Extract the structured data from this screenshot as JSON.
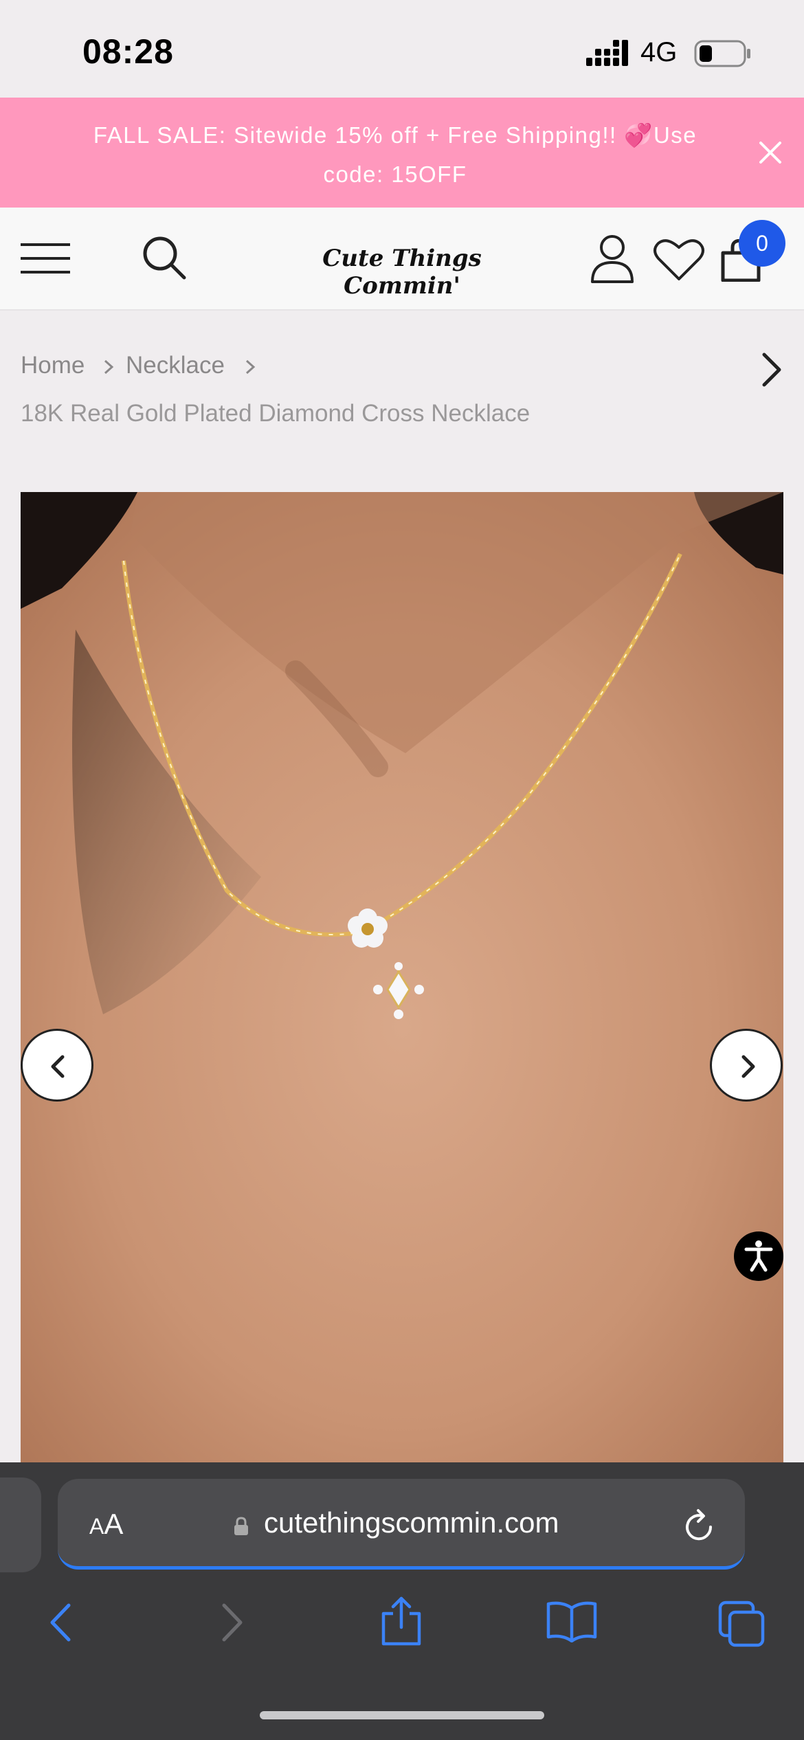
{
  "status_bar": {
    "time": "08:28",
    "network": "4G",
    "signal_icon": "signal-bars-icon",
    "battery_icon": "battery-low-icon"
  },
  "promo": {
    "text": "FALL SALE: Sitewide 15% off + Free Shipping!! 💞Use code: 15OFF",
    "close_icon": "close-icon",
    "background_color": "#ff98bd"
  },
  "header": {
    "logo_text": "Cute Things Commin'",
    "cart_count": "0",
    "badge_color": "#1f59e8",
    "icons": [
      "hamburger-menu-icon",
      "search-icon",
      "user-account-icon",
      "heart-icon",
      "shopping-bag-icon"
    ]
  },
  "breadcrumb": {
    "home": "Home",
    "category": "Necklace",
    "current": "18K Real Gold Plated Diamond Cross Necklace"
  },
  "gallery": {
    "image_alt": "gold necklace with flower charm and cross pendant worn on neck",
    "prev_icon": "chevron-left-icon",
    "next_icon": "chevron-right-icon",
    "accessibility_icon": "accessibility-icon"
  },
  "browser": {
    "text_size_label_small": "A",
    "text_size_label_large": "A",
    "url": "cutethingscommin.com",
    "accent_color": "#2d7cf6",
    "toolbar_icons": [
      "back-arrow-icon",
      "forward-arrow-icon",
      "share-icon",
      "bookmarks-icon",
      "tabs-icon"
    ]
  }
}
